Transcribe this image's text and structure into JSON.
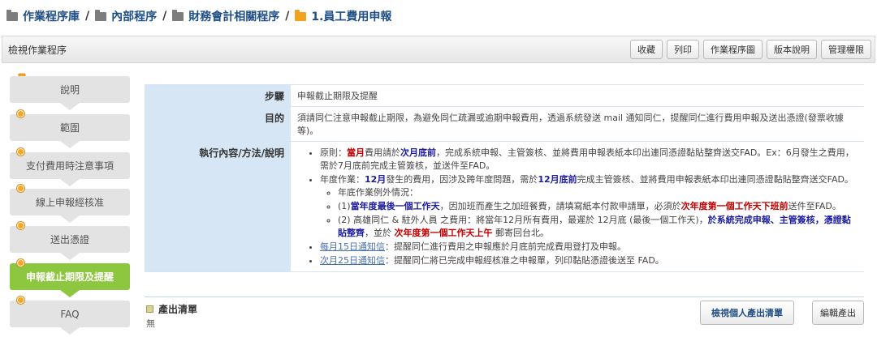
{
  "breadcrumb": {
    "items": [
      "作業程序庫",
      "內部程序",
      "財務會計相關程序",
      "1.員工費用申報"
    ],
    "separator": "/"
  },
  "header": {
    "title": "檢視作業程序",
    "buttons": [
      "收藏",
      "列印",
      "作業程序圖",
      "版本說明",
      "管理權限"
    ]
  },
  "sidebar": {
    "steps": [
      {
        "label": "說明"
      },
      {
        "label": "範圍"
      },
      {
        "label": "支付費用時注意事項"
      },
      {
        "label": "線上申報經核准"
      },
      {
        "label": "送出憑證"
      },
      {
        "label": "申報截止期限及提醒",
        "active": true
      },
      {
        "label": "FAQ"
      }
    ]
  },
  "detail": {
    "step_label": "步驟",
    "step_value": "申報截止期限及提醒",
    "purpose_label": "目的",
    "purpose_value": "須請同仁注意申報截止期限，為避免同仁疏漏或逾期申報費用，透過系統發送 mail 通知同仁，提醒同仁進行費用申報及送出憑證(發票收據等)。",
    "method_label": "執行內容/方法/說明",
    "b1": {
      "t1": "原則：",
      "r1": "當月",
      "t2": "費用請於",
      "b2": "次月底前",
      "t3": "，完成系統申報、主管簽核、並將費用申報表紙本印出連同憑證黏貼整齊送交FAD。Ex：6月發生之費用，需於7月底前完成主管簽核，並送件至FAD。"
    },
    "b2": {
      "t1": "年度作業：",
      "b1": "12月",
      "t2": "發生的費用，因涉及跨年度問題，需於",
      "b2": "12月底前",
      "t3": "完成主管簽核、並將費用申報表紙本印出連同憑證黏貼整齊送交FAD。"
    },
    "b2_sub_intro": "年底作業例外情況：",
    "s1": {
      "t1": "(1)",
      "b1": "當年度最後一個工作天",
      "t2": "，因加班而產生之加班餐費，請填寫紙本付款申請單，必須於",
      "r1": "次年度第一個工作天下班前",
      "t3": "送件至FAD。"
    },
    "s2": {
      "t1": "(2) 高雄同仁 & 駐外人員 之費用：將當年12月所有費用，最遲於 12月底 (最後一個工作天)，",
      "b1": "於系統完成申報、主管簽核，憑證黏貼整齊",
      "t2": "，並於 ",
      "r1": "次年度第一個工作天上午",
      "t3": " 郵寄回台北。"
    },
    "b3": {
      "link": "每月15日通知信",
      "text": "：提醒同仁進行費用之申報應於月底前完成費用登打及申報。"
    },
    "b4": {
      "link": "次月25日通知信",
      "text": "：提醒同仁將已完成申報經核准之申報單，列印黏貼憑證後送至 FAD。"
    }
  },
  "outputs": {
    "title": "產出清單",
    "empty_text": "無",
    "view_button": "檢視個人產出清單",
    "edit_button": "編輯產出"
  },
  "colors": {
    "link_blue": "#1f4e85",
    "active_step": "#8dc63f",
    "label_bg": "#d7e6f4",
    "emphasis_red": "#c00000",
    "folder_orange": "#f3a21d"
  }
}
